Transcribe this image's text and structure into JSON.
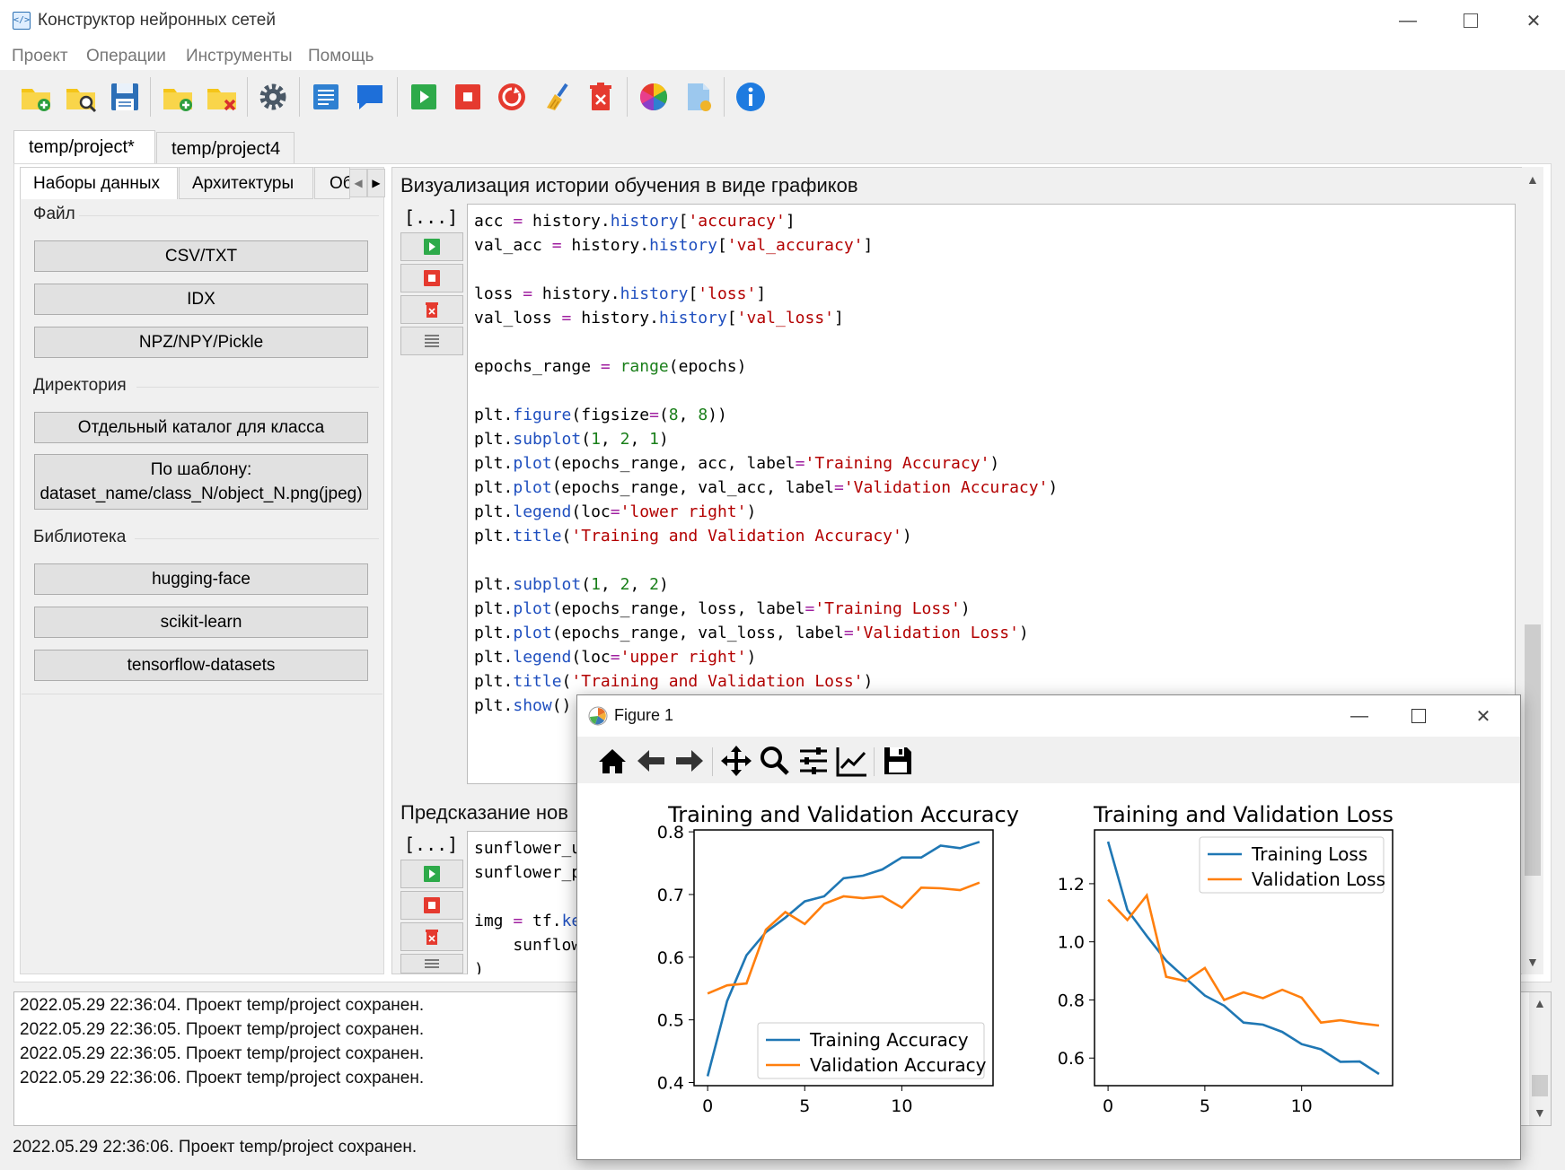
{
  "window": {
    "title": "Конструктор нейронных сетей"
  },
  "menu": [
    "Проект",
    "Операции",
    "Инструменты",
    "Помощь"
  ],
  "project_tabs": [
    "temp/project*",
    "temp/project4"
  ],
  "left_tabs": [
    "Наборы данных",
    "Архитектуры",
    "Об"
  ],
  "groups": {
    "file": {
      "title": "Файл",
      "buttons": [
        "CSV/TXT",
        "IDX",
        "NPZ/NPY/Pickle"
      ]
    },
    "directory": {
      "title": "Директория",
      "buttons": [
        "Отдельный каталог для класса",
        "По шаблону:\ndataset_name/class_N/object_N.png(jpeg)"
      ]
    },
    "library": {
      "title": "Библиотека",
      "buttons": [
        "hugging-face",
        "scikit-learn",
        "tensorflow-datasets"
      ]
    }
  },
  "cell1": {
    "title": "Визуализация истории обучения в виде графиков",
    "dots": "[...]",
    "code": [
      "acc = history.history['accuracy']",
      "val_acc = history.history['val_accuracy']",
      "",
      "loss = history.history['loss']",
      "val_loss = history.history['val_loss']",
      "",
      "epochs_range = range(epochs)",
      "",
      "plt.figure(figsize=(8, 8))",
      "plt.subplot(1, 2, 1)",
      "plt.plot(epochs_range, acc, label='Training Accuracy')",
      "plt.plot(epochs_range, val_acc, label='Validation Accuracy')",
      "plt.legend(loc='lower right')",
      "plt.title('Training and Validation Accuracy')",
      "",
      "plt.subplot(1, 2, 2)",
      "plt.plot(epochs_range, loss, label='Training Loss')",
      "plt.plot(epochs_range, val_loss, label='Validation Loss')",
      "plt.legend(loc='upper right')",
      "plt.title('Training and Validation Loss')",
      "plt.show()"
    ]
  },
  "cell2": {
    "title": "Предсказание нов",
    "dots": "[...]",
    "code": [
      "sunflower_u",
      "sunflower_p",
      "",
      "img = tf.ke",
      "    sunflow",
      ")"
    ]
  },
  "log": [
    "2022.05.29 22:36:04. Проект temp/project сохранен.",
    "2022.05.29 22:36:05. Проект temp/project сохранен.",
    "2022.05.29 22:36:05. Проект temp/project сохранен.",
    "2022.05.29 22:36:06. Проект temp/project сохранен."
  ],
  "status": "2022.05.29 22:36:06. Проект temp/project сохранен.",
  "figure": {
    "title": "Figure 1"
  },
  "colors": {
    "series1": "#1f77b4",
    "series2": "#ff7f0e"
  },
  "chart_data": [
    {
      "type": "line",
      "title": "Training and Validation Accuracy",
      "x": [
        0,
        1,
        2,
        3,
        4,
        5,
        6,
        7,
        8,
        9,
        10,
        11,
        12,
        13,
        14
      ],
      "series": [
        {
          "name": "Training Accuracy",
          "values": [
            0.41,
            0.53,
            0.603,
            0.64,
            0.663,
            0.689,
            0.697,
            0.726,
            0.73,
            0.74,
            0.759,
            0.759,
            0.778,
            0.774,
            0.784
          ]
        },
        {
          "name": "Validation Accuracy",
          "values": [
            0.542,
            0.555,
            0.558,
            0.644,
            0.672,
            0.653,
            0.685,
            0.697,
            0.694,
            0.697,
            0.679,
            0.711,
            0.71,
            0.707,
            0.719
          ]
        }
      ],
      "xlim": [
        -0.7,
        14.7
      ],
      "ylim": [
        0.395,
        0.803
      ],
      "xticks": [
        0,
        5,
        10
      ],
      "yticks": [
        0.4,
        0.5,
        0.6,
        0.7,
        0.8
      ],
      "legend": "lower right"
    },
    {
      "type": "line",
      "title": "Training and Validation Loss",
      "x": [
        0,
        1,
        2,
        3,
        4,
        5,
        6,
        7,
        8,
        9,
        10,
        11,
        12,
        13,
        14
      ],
      "series": [
        {
          "name": "Training Loss",
          "values": [
            1.345,
            1.11,
            1.02,
            0.935,
            0.875,
            0.815,
            0.78,
            0.722,
            0.715,
            0.69,
            0.648,
            0.63,
            0.587,
            0.588,
            0.545
          ]
        },
        {
          "name": "Validation Loss",
          "values": [
            1.145,
            1.075,
            1.16,
            0.88,
            0.865,
            0.91,
            0.8,
            0.826,
            0.806,
            0.835,
            0.808,
            0.722,
            0.73,
            0.72,
            0.712
          ]
        }
      ],
      "xlim": [
        -0.7,
        14.7
      ],
      "ylim": [
        0.505,
        1.385
      ],
      "xticks": [
        0,
        5,
        10
      ],
      "yticks": [
        0.6,
        0.8,
        1.0,
        1.2
      ],
      "legend": "upper right"
    }
  ]
}
